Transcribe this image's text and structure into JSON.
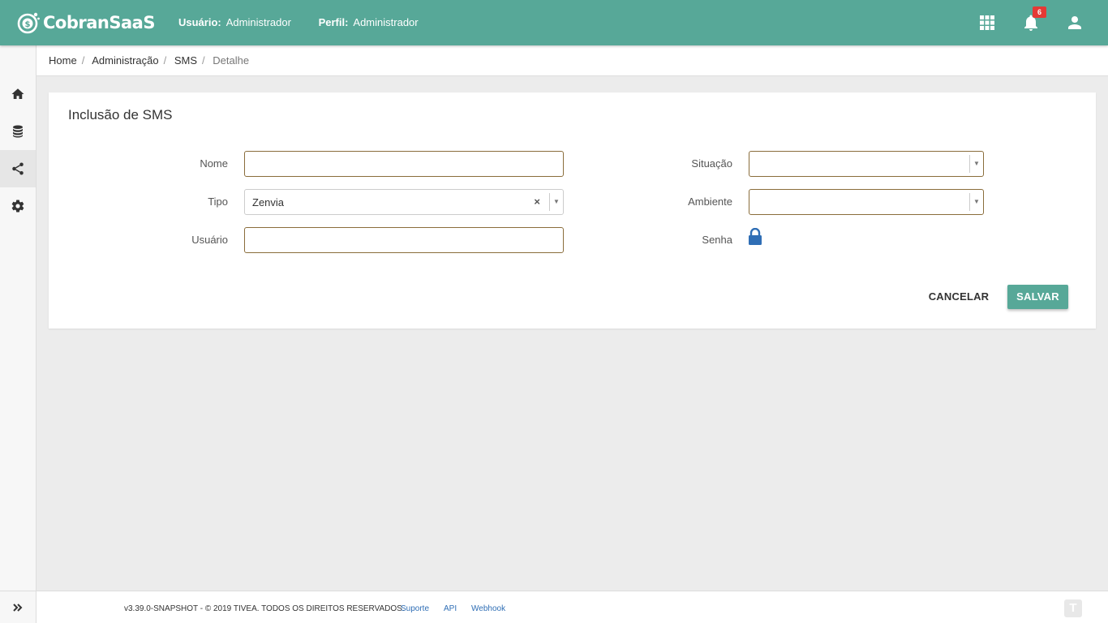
{
  "header": {
    "brand": "CobranSaaS",
    "user_label": "Usuário:",
    "user_value": "Administrador",
    "profile_label": "Perfil:",
    "profile_value": "Administrador",
    "notification_count": "6",
    "icons": [
      "apps-grid-icon",
      "bell-icon",
      "person-icon"
    ],
    "color": "#57a898"
  },
  "sidebar": {
    "items": [
      {
        "icon": "home-icon"
      },
      {
        "icon": "database-icon"
      },
      {
        "icon": "share-icon",
        "active": true
      },
      {
        "icon": "gear-icon"
      }
    ],
    "expand_icon": "double-chevron-right-icon"
  },
  "breadcrumb": {
    "items": [
      "Home",
      "Administração",
      "SMS"
    ],
    "current": "Detalhe"
  },
  "form": {
    "title": "Inclusão de SMS",
    "nome_label": "Nome",
    "nome_value": "",
    "tipo_label": "Tipo",
    "tipo_value": "Zenvia",
    "tipo_clear": "×",
    "usuario_label": "Usuário",
    "usuario_value": "",
    "situacao_label": "Situação",
    "situacao_value": "",
    "ambiente_label": "Ambiente",
    "ambiente_value": "",
    "senha_label": "Senha",
    "senha_icon": "lock-icon",
    "cancel_label": "CANCELAR",
    "save_label": "SALVAR"
  },
  "footer": {
    "copyright": "v3.39.0-SNAPSHOT - © 2019 TIVEA. TODOS OS DIREITOS RESERVADOS.",
    "links": [
      "Suporte",
      "API",
      "Webhook"
    ],
    "logo_icon": "tivea-logo-icon"
  }
}
